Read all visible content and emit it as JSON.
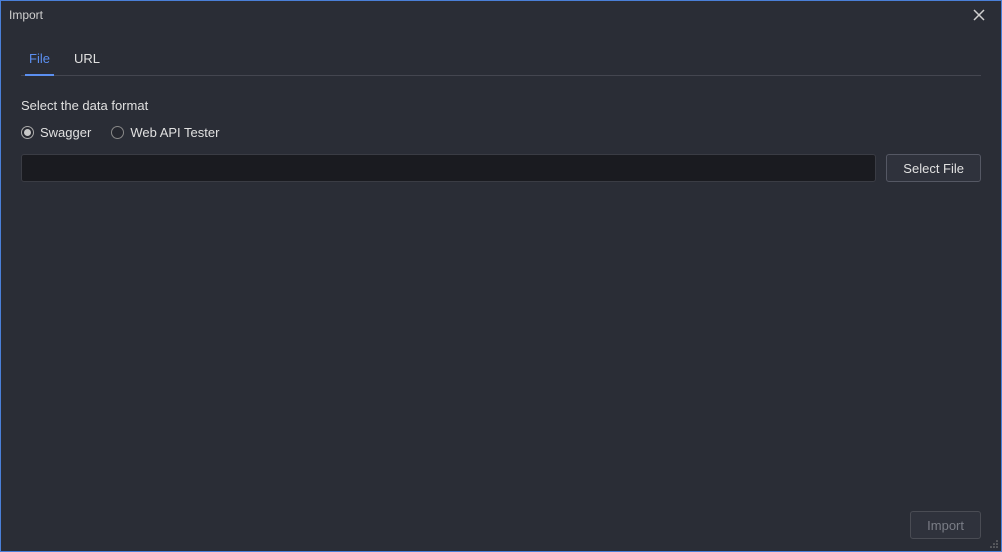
{
  "titlebar": {
    "title": "Import"
  },
  "tabs": {
    "items": [
      {
        "label": "File",
        "active": true
      },
      {
        "label": "URL",
        "active": false
      }
    ]
  },
  "section": {
    "label": "Select the data format"
  },
  "radios": {
    "items": [
      {
        "label": "Swagger",
        "selected": true
      },
      {
        "label": "Web API Tester",
        "selected": false
      }
    ]
  },
  "fileInput": {
    "value": "",
    "placeholder": ""
  },
  "buttons": {
    "selectFile": "Select File",
    "import": "Import"
  }
}
